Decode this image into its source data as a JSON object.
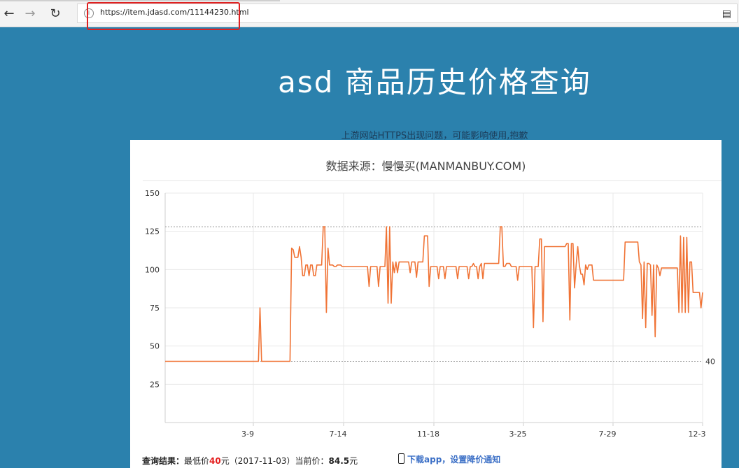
{
  "browser": {
    "url": "https://item.jdasd.com/11144230.html"
  },
  "page": {
    "title": "asd 商品历史价格查询",
    "notice": "上游网站HTTPS出现问题，可能影响使用,抱歉",
    "card_title": "数据来源：慢慢买(MANMANBUY.COM)"
  },
  "result": {
    "label": "查询结果：",
    "lowest_prefix": "最低价",
    "lowest_value": "40",
    "lowest_unit": "元",
    "lowest_date": "（2017-11-03）",
    "current_prefix": "当前价：",
    "current_value": "84.5",
    "current_unit": "元",
    "app_link": "下载app，设置降价通知"
  },
  "colors": {
    "line": "#f07335",
    "background": "#2b81ad"
  },
  "chart_data": {
    "type": "line",
    "x_tick_labels": [
      "3-9",
      "7-14",
      "11-18",
      "3-25",
      "7-29",
      "12-3"
    ],
    "y_ticks": [
      25,
      50,
      75,
      100,
      125,
      150
    ],
    "ylim": [
      0,
      150
    ],
    "reference_lines": [
      128,
      40
    ],
    "reference_label": "40",
    "grid": true,
    "series": [
      {
        "values": [
          40,
          40,
          40,
          40,
          40,
          40,
          40,
          40,
          40,
          40,
          40,
          40,
          40,
          40,
          40,
          40,
          40,
          40,
          40,
          40,
          40,
          40,
          40,
          40,
          40,
          40,
          40,
          40,
          40,
          40,
          40,
          40,
          40,
          40,
          40,
          40,
          40,
          40,
          40,
          40,
          40,
          40,
          40,
          40,
          40,
          40,
          40,
          40,
          40,
          40,
          40,
          40,
          40,
          40,
          40,
          40,
          40,
          40,
          40,
          40,
          75,
          40,
          40,
          40,
          40,
          40,
          40,
          40,
          40,
          40,
          40,
          40,
          40,
          40,
          40,
          40,
          40,
          40,
          40,
          40,
          114,
          113,
          108,
          108,
          108,
          115,
          108,
          96,
          96,
          103,
          103,
          96,
          103,
          103,
          96,
          96,
          103,
          103,
          103,
          103,
          128,
          128,
          72,
          114,
          103,
          103,
          103,
          102,
          102,
          103,
          103,
          103,
          102,
          102,
          102,
          102,
          102,
          102,
          102,
          102,
          102,
          102,
          102,
          102,
          102,
          102,
          102,
          102,
          102,
          89,
          102,
          102,
          102,
          102,
          102,
          89,
          102,
          102,
          102,
          102,
          128,
          78,
          128,
          78,
          105,
          98,
          105,
          98,
          105,
          105,
          105,
          105,
          105,
          105,
          105,
          98,
          105,
          105,
          105,
          95,
          105,
          105,
          105,
          105,
          122,
          122,
          122,
          89,
          102,
          102,
          102,
          102,
          102,
          94,
          102,
          102,
          102,
          94,
          102,
          102,
          102,
          102,
          102,
          102,
          102,
          94,
          102,
          102,
          102,
          102,
          102,
          102,
          94,
          102,
          102,
          104,
          102,
          102,
          94,
          102,
          104,
          94,
          104,
          104,
          104,
          104,
          104,
          104,
          104,
          104,
          104,
          104,
          128,
          128,
          102,
          102,
          104,
          104,
          104,
          102,
          102,
          102,
          102,
          93,
          102,
          102,
          102,
          102,
          102,
          102,
          102,
          102,
          102,
          62,
          102,
          102,
          102,
          120,
          120,
          66,
          115,
          115,
          115,
          115,
          115,
          115,
          115,
          115,
          115,
          115,
          115,
          115,
          115,
          115,
          117,
          117,
          67,
          117,
          117,
          88,
          103,
          115,
          103,
          97,
          97,
          90,
          103,
          100,
          103,
          103,
          103,
          93,
          93,
          93,
          93,
          93,
          93,
          93,
          93,
          93,
          93,
          93,
          93,
          93,
          93,
          93,
          93,
          93,
          93,
          93,
          93,
          118,
          118,
          118,
          118,
          118,
          118,
          118,
          118,
          118,
          105,
          103,
          68,
          105,
          62,
          104,
          104,
          103,
          70,
          103,
          56,
          103,
          101,
          96,
          101,
          101,
          101,
          101,
          101,
          101,
          101,
          101,
          101,
          101,
          101,
          72,
          122,
          72,
          121,
          72,
          121,
          72,
          105,
          105,
          85,
          85,
          85,
          85,
          85,
          75,
          85
        ]
      }
    ]
  }
}
